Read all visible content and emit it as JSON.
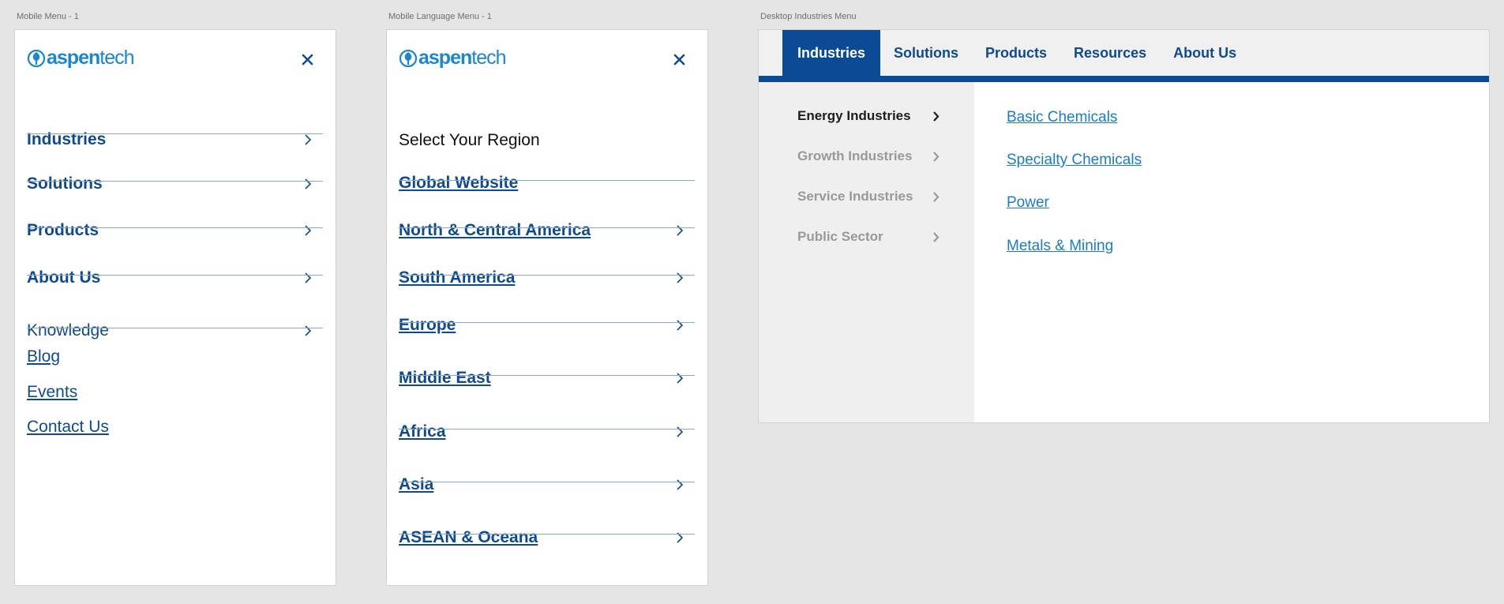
{
  "frames": {
    "mobile_menu": "Mobile Menu - 1",
    "language_menu": "Mobile Language Menu - 1",
    "desktop_menu": "Desktop Industries Menu"
  },
  "logo": {
    "bold": "aspen",
    "light": "tech",
    "icon": "aspentech-leaf-icon"
  },
  "colors": {
    "brand_blue": "#0f4a8f",
    "nav_active": "#0b4a94",
    "link_blue": "#1a7cc9",
    "logo_blue": "#1a86d0"
  },
  "mobile_menu": {
    "primary": [
      "Industries",
      "Solutions",
      "Products",
      "About Us"
    ],
    "secondary": [
      "Knowledge"
    ],
    "links": [
      "Blog",
      "Events",
      "Contact Us"
    ]
  },
  "language_menu": {
    "title": "Select Your Region",
    "global": "Global Website",
    "regions": [
      "North & Central America",
      "South America",
      "Europe",
      "Middle East",
      "Africa",
      "Asia",
      "ASEAN & Oceana"
    ]
  },
  "desktop_menu": {
    "nav": [
      "Industries",
      "Solutions",
      "Products",
      "Resources",
      "About Us"
    ],
    "active_nav": "Industries",
    "categories": [
      "Energy Industries",
      "Growth Industries",
      "Service Industries",
      "Public Sector"
    ],
    "active_category": "Energy Industries",
    "links": [
      "Basic Chemicals",
      "Specialty Chemicals",
      "Power",
      "Metals & Mining"
    ]
  }
}
